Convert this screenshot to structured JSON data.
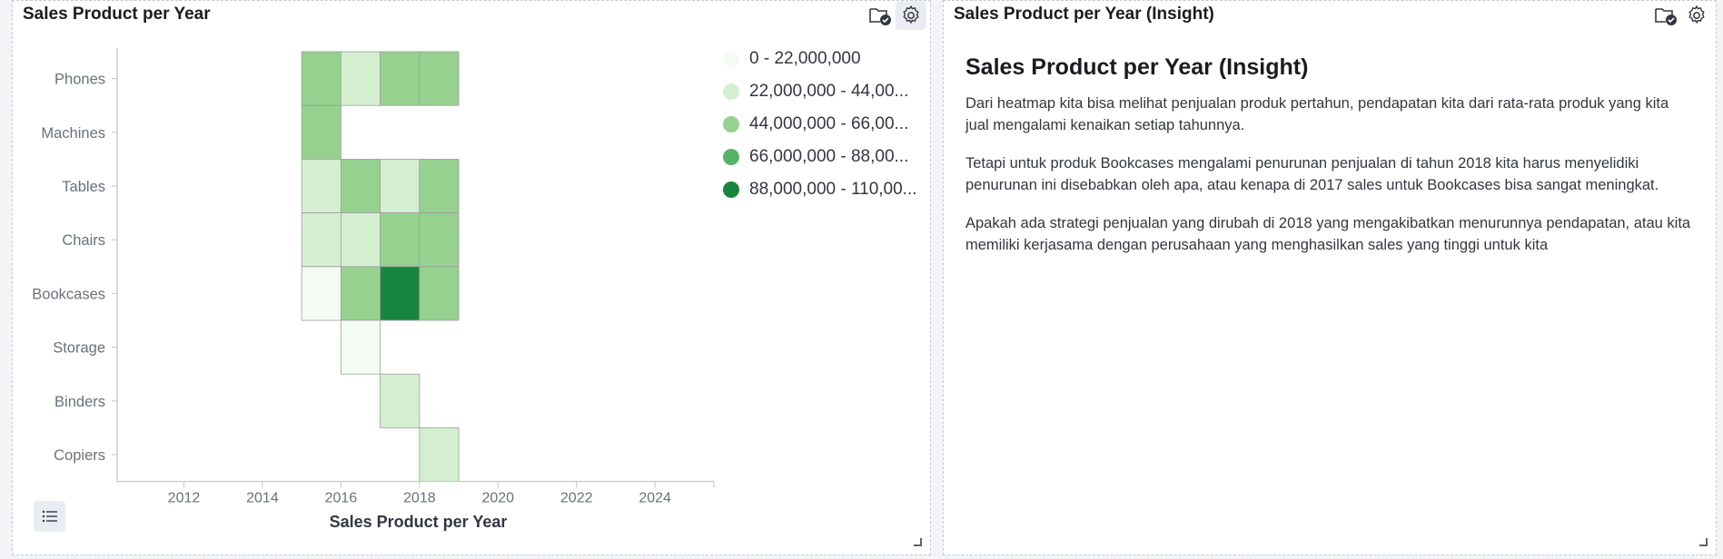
{
  "left_panel": {
    "title": "Sales Product per Year",
    "legend": [
      {
        "label": "0 - 22,000,000",
        "color": "#f4fbf2"
      },
      {
        "label": "22,000,000 - 44,00...",
        "color": "#d4efcf"
      },
      {
        "label": "44,000,000 - 66,00...",
        "color": "#96d190"
      },
      {
        "label": "66,000,000 - 88,00...",
        "color": "#55b465"
      },
      {
        "label": "88,000,000 - 110,00...",
        "color": "#198640"
      }
    ]
  },
  "right_panel": {
    "title": "Sales Product per Year (Insight)",
    "heading": "Sales Product per Year (Insight)",
    "paragraphs": [
      "Dari heatmap kita bisa melihat penjualan produk pertahun, pendapatan kita dari rata-rata produk yang kita jual mengalami kenaikan setiap tahunnya.",
      "Tetapi untuk produk Bookcases mengalami penurunan penjualan di tahun 2018 kita harus menyelidiki penurunan ini disebabkan oleh apa, atau kenapa di 2017 sales untuk Bookcases bisa sangat meningkat.",
      "Apakah ada strategi penjualan yang dirubah di 2018 yang mengakibatkan menurunnya pendapatan, atau kita memiliki kerjasama dengan perusahaan yang menghasilkan sales yang tinggi untuk kita"
    ]
  },
  "icons": {
    "save": "folder-check-icon",
    "settings": "gear-icon",
    "legend_toggle": "list-icon"
  },
  "chart_data": {
    "type": "heatmap",
    "xlabel": "Sales Product per Year",
    "ylabel": "",
    "x_ticks": [
      2012,
      2014,
      2016,
      2018,
      2020,
      2022,
      2024
    ],
    "xlim": [
      2010.3,
      2025.5
    ],
    "categories": [
      "Phones",
      "Machines",
      "Tables",
      "Chairs",
      "Bookcases",
      "Storage",
      "Binders",
      "Copiers"
    ],
    "legend_position": "right",
    "cells": [
      {
        "y": "Phones",
        "x": 2015,
        "range": 2
      },
      {
        "y": "Phones",
        "x": 2016,
        "range": 1
      },
      {
        "y": "Phones",
        "x": 2017,
        "range": 2
      },
      {
        "y": "Phones",
        "x": 2018,
        "range": 2
      },
      {
        "y": "Machines",
        "x": 2015,
        "range": 2
      },
      {
        "y": "Tables",
        "x": 2015,
        "range": 1
      },
      {
        "y": "Tables",
        "x": 2016,
        "range": 2
      },
      {
        "y": "Tables",
        "x": 2017,
        "range": 1
      },
      {
        "y": "Tables",
        "x": 2018,
        "range": 2
      },
      {
        "y": "Chairs",
        "x": 2015,
        "range": 1
      },
      {
        "y": "Chairs",
        "x": 2016,
        "range": 1
      },
      {
        "y": "Chairs",
        "x": 2017,
        "range": 2
      },
      {
        "y": "Chairs",
        "x": 2018,
        "range": 2
      },
      {
        "y": "Bookcases",
        "x": 2015,
        "range": 0
      },
      {
        "y": "Bookcases",
        "x": 2016,
        "range": 2
      },
      {
        "y": "Bookcases",
        "x": 2017,
        "range": 4
      },
      {
        "y": "Bookcases",
        "x": 2018,
        "range": 2
      },
      {
        "y": "Storage",
        "x": 2016,
        "range": 0
      },
      {
        "y": "Binders",
        "x": 2017,
        "range": 1
      },
      {
        "y": "Copiers",
        "x": 2018,
        "range": 1
      }
    ]
  }
}
